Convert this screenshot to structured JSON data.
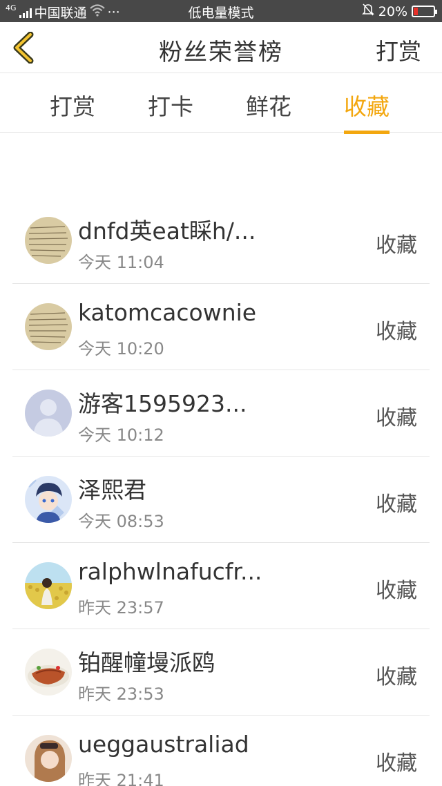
{
  "status_bar": {
    "carrier": "中国联通",
    "network": "4G",
    "dots": "···",
    "mode": "低电量模式",
    "battery_level": "20%",
    "battery_fraction": 0.2,
    "battery_color": "#e8312a"
  },
  "navbar": {
    "title": "粉丝荣誉榜",
    "action": "打赏"
  },
  "tabs": [
    {
      "label": "打赏",
      "active": false
    },
    {
      "label": "打卡",
      "active": false
    },
    {
      "label": "鲜花",
      "active": false
    },
    {
      "label": "收藏",
      "active": true
    }
  ],
  "accent_color": "#f3a70f",
  "rows": [
    {
      "name": "dnfd英eat睬h/...",
      "time": "今天 11:04",
      "action": "收藏",
      "avatar": "handwriting-avatar"
    },
    {
      "name": "katomcacownie",
      "time": "今天 10:20",
      "action": "收藏",
      "avatar": "handwriting-avatar"
    },
    {
      "name": "游客1595923...",
      "time": "今天 10:12",
      "action": "收藏",
      "avatar": "default-user-avatar"
    },
    {
      "name": "泽熙君",
      "time": "今天 08:53",
      "action": "收藏",
      "avatar": "anime-avatar"
    },
    {
      "name": "ralphwlnafucfr...",
      "time": "昨天 23:57",
      "action": "收藏",
      "avatar": "photo-avatar"
    },
    {
      "name": "铂醒幢墁派鸥",
      "time": "昨天 23:53",
      "action": "收藏",
      "avatar": "food-avatar"
    },
    {
      "name": "ueggaustraliad",
      "time": "昨天 21:41",
      "action": "收藏",
      "avatar": "portrait-avatar"
    }
  ]
}
